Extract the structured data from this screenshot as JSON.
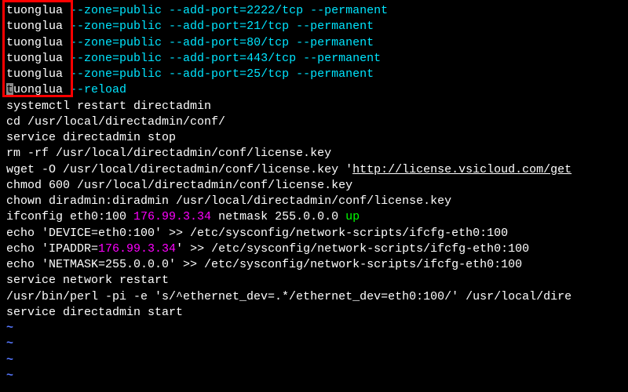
{
  "lines": {
    "l1": {
      "prefix": "tuonglua ",
      "zone": "--zone=public ",
      "addport": "--add-port=2222/tcp ",
      "permanent": "--permanent"
    },
    "l2": {
      "prefix": "tuonglua ",
      "zone": "--zone=public ",
      "addport": "--add-port=21/tcp ",
      "permanent": "--permanent"
    },
    "l3": {
      "prefix": "tuonglua ",
      "zone": "--zone=public ",
      "addport": "--add-port=80/tcp ",
      "permanent": "--permanent"
    },
    "l4": {
      "prefix": "tuonglua ",
      "zone": "--zone=public ",
      "addport": "--add-port=443/tcp ",
      "permanent": "--permanent"
    },
    "l5": {
      "prefix": "tuonglua ",
      "zone": "--zone=public ",
      "addport": "--add-port=25/tcp ",
      "permanent": "--permanent"
    },
    "l6": {
      "cursor": "t",
      "rest": "uonglua ",
      "reload": "--reload"
    },
    "l7": "systemctl restart directadmin",
    "l8": "cd /usr/local/directadmin/conf/",
    "l9": "service directadmin stop",
    "l10": "rm -rf /usr/local/directadmin/conf/license.key",
    "l11": {
      "pre": "wget -O /usr/local/directadmin/conf/license.key '",
      "url": "http://license.vsicloud.com/get"
    },
    "l12": "chmod 600 /usr/local/directadmin/conf/license.key",
    "l13": "chown diradmin:diradmin /usr/local/directadmin/conf/license.key",
    "l14": {
      "pre": "ifconfig eth0:100 ",
      "ip": "176.99.3.34",
      "mid": " netmask 255.0.0.0 ",
      "up": "up"
    },
    "l15": "echo 'DEVICE=eth0:100' >> /etc/sysconfig/network-scripts/ifcfg-eth0:100",
    "l16": {
      "pre": "echo 'IPADDR=",
      "ip": "176.99.3.34",
      "post": "' >> /etc/sysconfig/network-scripts/ifcfg-eth0:100"
    },
    "l17": "echo 'NETMASK=255.0.0.0' >> /etc/sysconfig/network-scripts/ifcfg-eth0:100",
    "l18": "service network restart",
    "l19": "/usr/bin/perl -pi -e 's/^ethernet_dev=.*/ethernet_dev=eth0:100/' /usr/local/dire",
    "l20": "service directadmin start",
    "tilde": "~"
  }
}
